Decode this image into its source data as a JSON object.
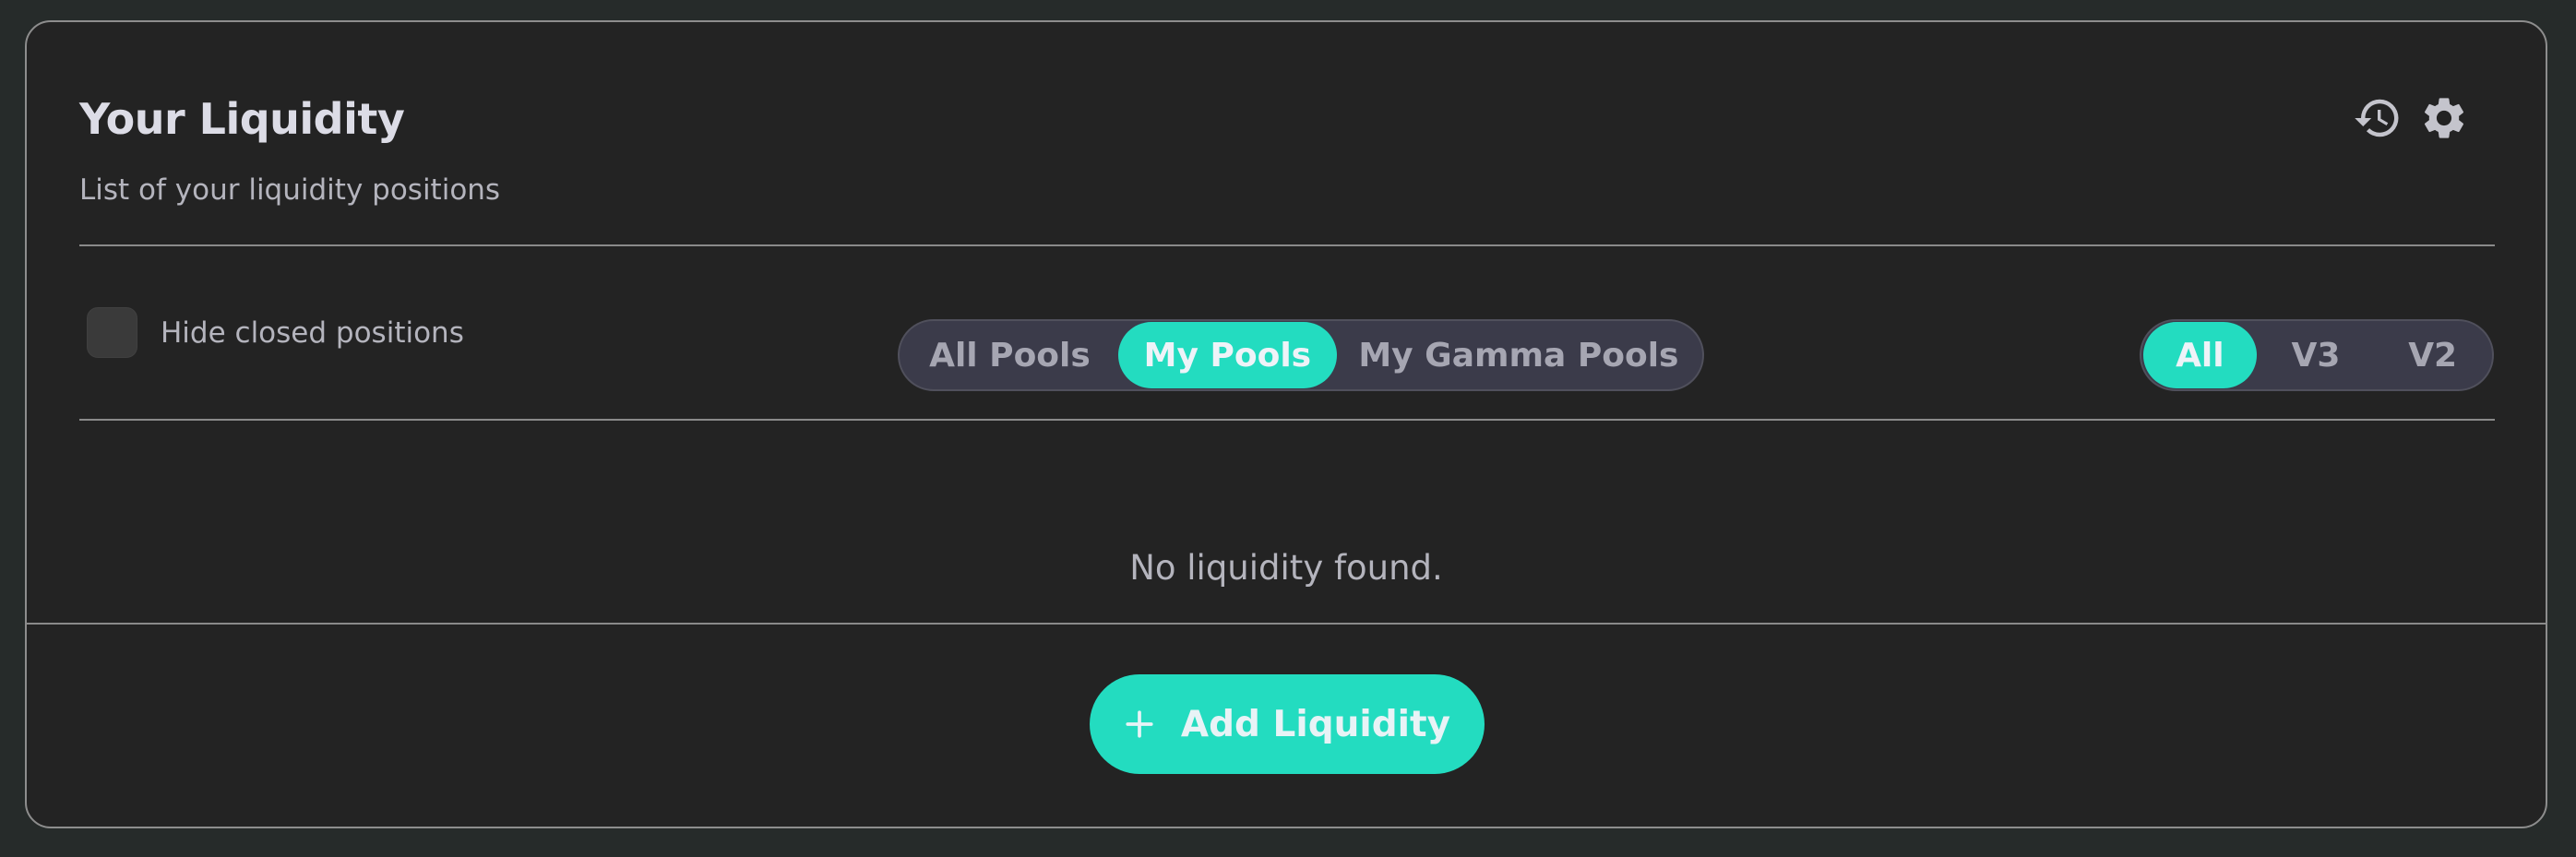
{
  "header": {
    "title": "Your Liquidity",
    "subtitle": "List of your liquidity positions",
    "history_icon": "history-icon",
    "settings_icon": "gear-icon"
  },
  "filters": {
    "hide_closed_label": "Hide closed positions",
    "hide_closed_checked": false,
    "pool_tabs": [
      {
        "label": "All Pools",
        "active": false
      },
      {
        "label": "My Pools",
        "active": true
      },
      {
        "label": "My Gamma Pools",
        "active": false
      }
    ],
    "version_tabs": [
      {
        "label": "All",
        "active": true
      },
      {
        "label": "V3",
        "active": false
      },
      {
        "label": "V2",
        "active": false
      }
    ]
  },
  "empty_state": {
    "message": "No liquidity found."
  },
  "footer": {
    "add_button_label": "Add Liquidity",
    "add_icon": "plus-icon"
  },
  "colors": {
    "accent": "#23dcc0",
    "card_bg": "#232323",
    "page_bg": "#262b2a",
    "tab_bg": "#3b3b4a"
  }
}
